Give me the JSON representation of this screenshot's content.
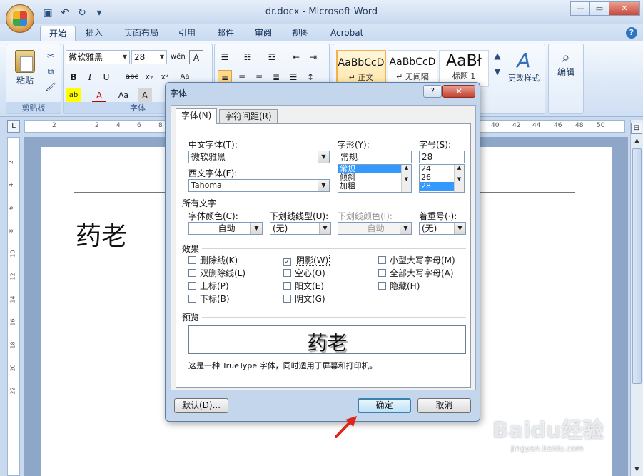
{
  "window": {
    "title": "dr.docx - Microsoft Word",
    "min_icon": "minimize-icon",
    "max_icon": "maximize-icon",
    "close_icon": "close-icon"
  },
  "qat": {
    "save": "save-icon",
    "undo": "undo-icon",
    "redo": "redo-icon",
    "more": "chevron-down-icon"
  },
  "tabs": [
    "开始",
    "插入",
    "页面布局",
    "引用",
    "邮件",
    "审阅",
    "视图",
    "Acrobat"
  ],
  "ribbon": {
    "paste_label": "粘贴",
    "clipboard_label": "剪贴板",
    "font_group_label": "字体",
    "font_name": "微软雅黑",
    "font_size": "28",
    "styles": [
      {
        "sample": "AaBbCcD",
        "name": "↵ 正文"
      },
      {
        "sample": "AaBbCcD",
        "name": "↵ 无间隔"
      },
      {
        "sample": "AaBł",
        "name": "标题 1"
      }
    ],
    "change_styles": "更改样式",
    "edit": "编辑"
  },
  "ruler_ticks": [
    "2",
    "2",
    "4",
    "6",
    "8",
    "40",
    "42",
    "44",
    "46",
    "48",
    "50"
  ],
  "vruler_ticks": [
    "2",
    "4",
    "6",
    "8",
    "10",
    "12",
    "14",
    "16",
    "18",
    "20",
    "22"
  ],
  "document": {
    "text": "药老"
  },
  "dialog": {
    "title": "字体",
    "help": "?",
    "close": "✕",
    "tab_font": "字体(N)",
    "tab_spacing": "字符间距(R)",
    "cn_font_label": "中文字体(T):",
    "cn_font_value": "微软雅黑",
    "west_font_label": "西文字体(F):",
    "west_font_value": "Tahoma",
    "style_label": "字形(Y):",
    "style_value": "常规",
    "style_options": [
      "常规",
      "倾斜",
      "加粗"
    ],
    "size_label": "字号(S):",
    "size_value": "28",
    "size_options": [
      "24",
      "26",
      "28"
    ],
    "all_text_label": "所有文字",
    "color_label": "字体颜色(C):",
    "color_value": "自动",
    "underline_label": "下划线线型(U):",
    "underline_value": "(无)",
    "underline_color_label": "下划线颜色(I):",
    "underline_color_value": "自动",
    "emphasis_label": "着重号(·):",
    "emphasis_value": "(无)",
    "effects_label": "效果",
    "effects": {
      "strike": "删除线(K)",
      "dstrike": "双删除线(L)",
      "sup": "上标(P)",
      "sub": "下标(B)",
      "shadow": "阴影(W)",
      "outline": "空心(O)",
      "emboss": "阳文(E)",
      "engrave": "阴文(G)",
      "smallcaps": "小型大写字母(M)",
      "allcaps": "全部大写字母(A)",
      "hidden": "隐藏(H)"
    },
    "preview_label": "预览",
    "preview_text": "药老",
    "preview_note": "这是一种 TrueType 字体，同时适用于屏幕和打印机。",
    "default_btn": "默认(D)...",
    "ok_btn": "确定",
    "cancel_btn": "取消"
  },
  "watermark": {
    "main": "Baidu经验",
    "sub": "jingyan.baidu.com"
  }
}
